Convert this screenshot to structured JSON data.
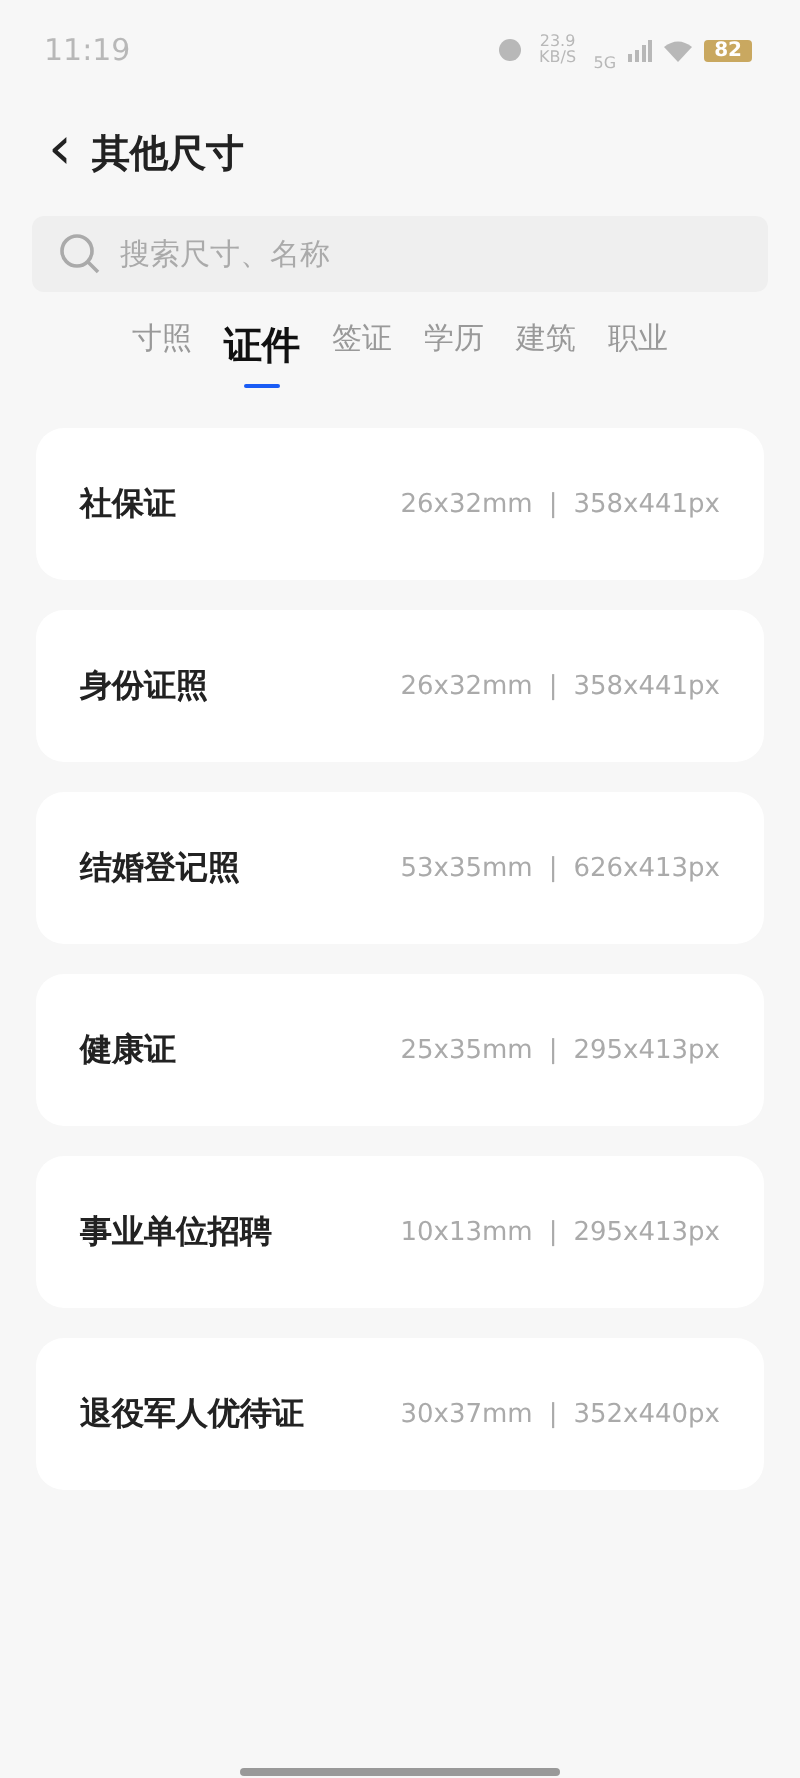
{
  "status_bar": {
    "time": "11:19",
    "speed": "23.9 KB/S",
    "network": "5G",
    "battery": "82"
  },
  "header": {
    "back": "‹",
    "title": "其他尺寸"
  },
  "search": {
    "placeholder": "搜索尺寸、名称"
  },
  "tabs": [
    {
      "label": "寸照",
      "selected": false
    },
    {
      "label": "证件",
      "selected": true
    },
    {
      "label": "签证",
      "selected": false
    },
    {
      "label": "学历",
      "selected": false
    },
    {
      "label": "建筑",
      "selected": false
    },
    {
      "label": "职业",
      "selected": false
    }
  ],
  "items": [
    {
      "name": "社保证",
      "mm": "26x32mm",
      "separator": "|",
      "px": "358x441px"
    },
    {
      "name": "身份证照",
      "mm": "26x32mm",
      "separator": "|",
      "px": "358x441px"
    },
    {
      "name": "结婚登记照",
      "mm": "53x35mm",
      "separator": "|",
      "px": "626x413px"
    },
    {
      "name": "健康证",
      "mm": "25x35mm",
      "separator": "|",
      "px": "295x413px"
    },
    {
      "name": "事业单位招聘",
      "mm": "10x13mm",
      "separator": "|",
      "px": "295x413px"
    },
    {
      "name": "退役军人优待证",
      "mm": "30x37mm",
      "separator": "|",
      "px": "352x440px"
    }
  ]
}
